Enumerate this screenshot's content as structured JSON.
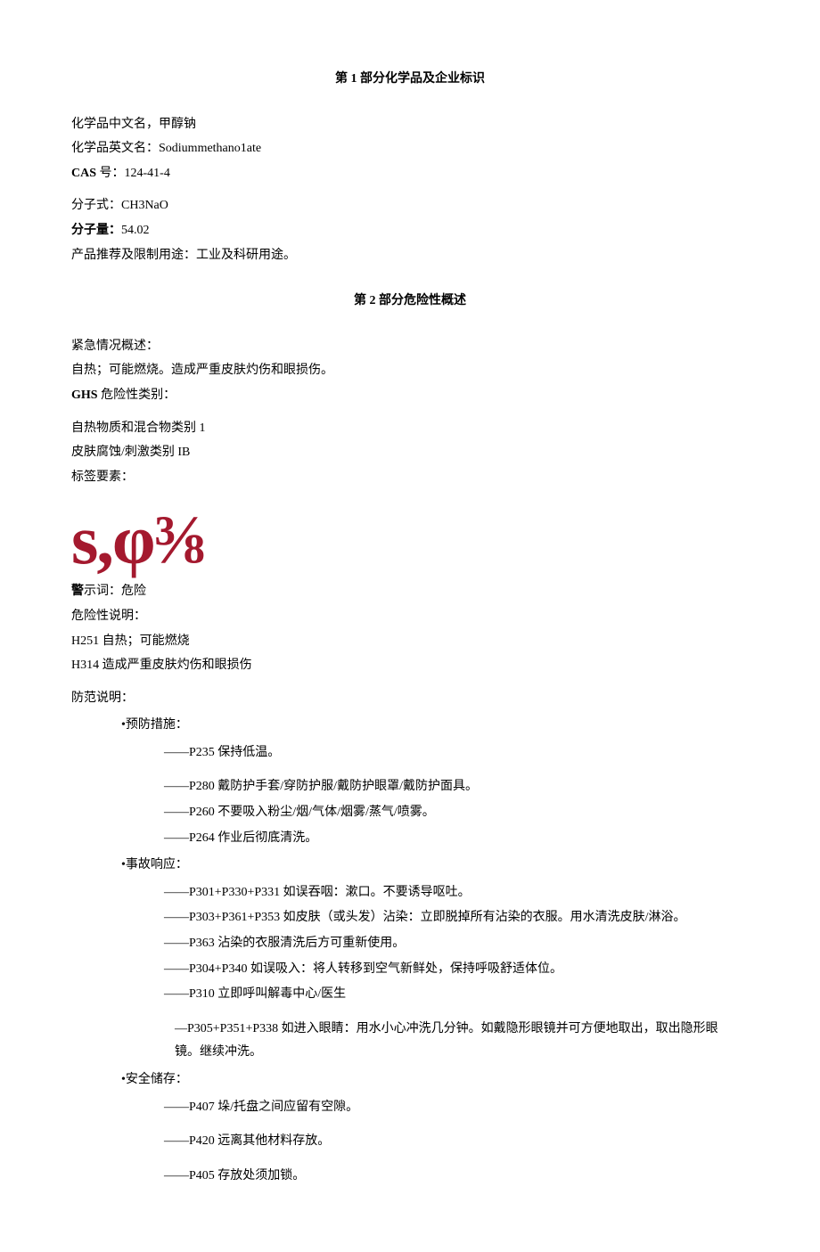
{
  "section1": {
    "title": "第 1 部分化学品及企业标识",
    "name_cn_label": "化学品中文名，甲醇钠",
    "name_en_label": "化学品英文名：Sodiummethano1ate",
    "cas_label_prefix": "CAS",
    "cas_label_suffix": " 号：124-41-4",
    "formula_label": "分子式：CH3NaO",
    "mw_prefix": "分子量：",
    "mw_value": "54.02",
    "use_label": "产品推荐及限制用途：工业及科研用途。"
  },
  "section2": {
    "title": "第 2 部分危险性概述",
    "emergency_head": "紧急情况概述：",
    "emergency_text": "自热；可能燃烧。造成严重皮肤灼伤和眼损伤。",
    "ghs_prefix": "GHS",
    "ghs_suffix": " 危险性类别：",
    "cat1": "自热物质和混合物类别 1",
    "cat2": "皮肤腐蚀/刺激类别 IB",
    "label_elements": "标签要素：",
    "pictogram_text": "s,φ⅜",
    "signal_prefix": "警",
    "signal_text": "示词：危险",
    "hazard_head": "危险性说明：",
    "h251": "H251 自热；可能燃烧",
    "h314": "H314 造成严重皮肤灼伤和眼损伤",
    "precaution_head": "防范说明：",
    "prevention_head": "•预防措施：",
    "prevention": {
      "p235": "——P235 保持低温。",
      "p280": "——P280 戴防护手套/穿防护服/戴防护眼罩/戴防护面具。",
      "p260": "——P260 不要吸入粉尘/烟/气体/烟雾/蒸气/喷雾。",
      "p264": "——P264 作业后彻底清洗。"
    },
    "response_head": "•事故响应：",
    "response": {
      "r1": "——P301+P330+P331 如误吞咽：漱口。不要诱导呕吐。",
      "r2": "——P303+P361+P353 如皮肤（或头发）沾染：立即脱掉所有沾染的衣服。用水清洗皮肤/淋浴。",
      "r3": "——P363 沾染的衣服清洗后方可重新使用。",
      "r4": "——P304+P340 如误吸入：将人转移到空气新鲜处，保持呼吸舒适体位。",
      "r5": "——P310 立即呼叫解毒中心/医生",
      "r6": "—P305+P351+P338 如进入眼睛：用水小心冲洗几分钟。如戴隐形眼镜并可方便地取出，取出隐形眼镜。继续冲洗。"
    },
    "storage_head": "•安全储存：",
    "storage": {
      "s1": "——P407 垛/托盘之间应留有空隙。",
      "s2": "——P420 远离其他材料存放。",
      "s3": "——P405 存放处须加锁。"
    }
  }
}
